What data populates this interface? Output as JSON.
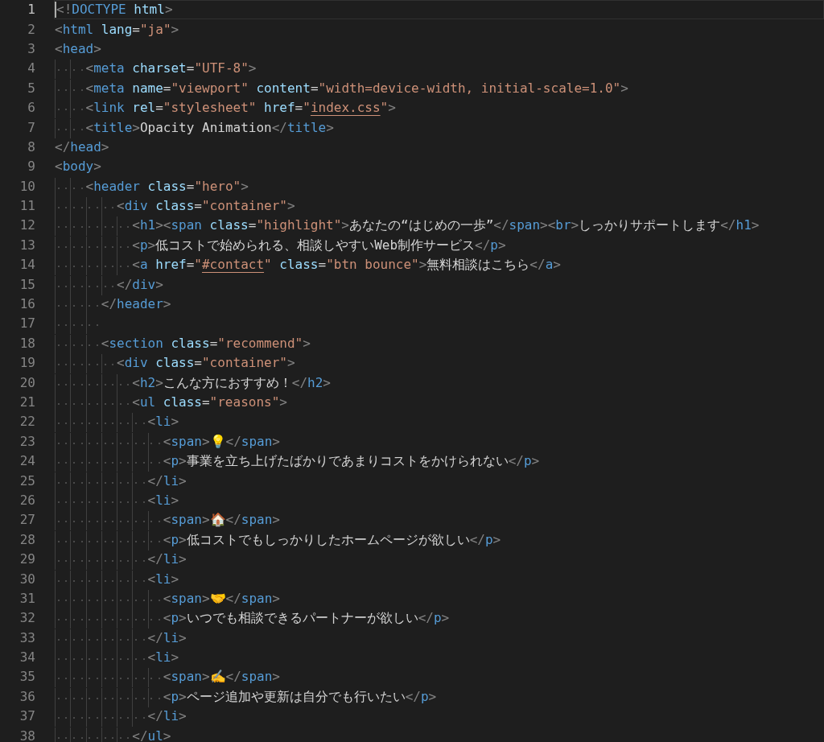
{
  "editor": {
    "lines": [
      {
        "number": "1",
        "current": true,
        "tokens": [
          {
            "kind": "punct",
            "text": "<!"
          },
          {
            "kind": "tag",
            "text": "DOCTYPE"
          },
          {
            "kind": "attr",
            "text": " html"
          },
          {
            "kind": "punct",
            "text": ">"
          }
        ]
      },
      {
        "number": "2",
        "current": false,
        "tokens": [
          {
            "kind": "punct",
            "text": "<"
          },
          {
            "kind": "tag",
            "text": "html"
          },
          {
            "kind": "attr",
            "text": " lang"
          },
          {
            "kind": "text",
            "text": "="
          },
          {
            "kind": "string",
            "text": "\"ja\""
          },
          {
            "kind": "punct",
            "text": ">"
          }
        ]
      },
      {
        "number": "3",
        "current": false,
        "tokens": [
          {
            "kind": "punct",
            "text": "<"
          },
          {
            "kind": "tag",
            "text": "head"
          },
          {
            "kind": "punct",
            "text": ">"
          }
        ]
      },
      {
        "number": "4",
        "current": false,
        "tokens": [
          {
            "kind": "punct",
            "text": "    <"
          },
          {
            "kind": "tag",
            "text": "meta"
          },
          {
            "kind": "attr",
            "text": " charset"
          },
          {
            "kind": "text",
            "text": "="
          },
          {
            "kind": "string",
            "text": "\"UTF-8\""
          },
          {
            "kind": "punct",
            "text": ">"
          }
        ]
      },
      {
        "number": "5",
        "current": false,
        "tokens": [
          {
            "kind": "punct",
            "text": "    <"
          },
          {
            "kind": "tag",
            "text": "meta"
          },
          {
            "kind": "attr",
            "text": " name"
          },
          {
            "kind": "text",
            "text": "="
          },
          {
            "kind": "string",
            "text": "\"viewport\""
          },
          {
            "kind": "attr",
            "text": " content"
          },
          {
            "kind": "text",
            "text": "="
          },
          {
            "kind": "string",
            "text": "\"width=device-width, initial-scale=1.0\""
          },
          {
            "kind": "punct",
            "text": ">"
          }
        ]
      },
      {
        "number": "6",
        "current": false,
        "tokens": [
          {
            "kind": "punct",
            "text": "    <"
          },
          {
            "kind": "tag",
            "text": "link"
          },
          {
            "kind": "attr",
            "text": " rel"
          },
          {
            "kind": "text",
            "text": "="
          },
          {
            "kind": "string",
            "text": "\"stylesheet\""
          },
          {
            "kind": "attr",
            "text": " href"
          },
          {
            "kind": "text",
            "text": "="
          },
          {
            "kind": "string",
            "text": "\""
          },
          {
            "kind": "link",
            "text": "index.css"
          },
          {
            "kind": "string",
            "text": "\""
          },
          {
            "kind": "punct",
            "text": ">"
          }
        ]
      },
      {
        "number": "7",
        "current": false,
        "tokens": [
          {
            "kind": "punct",
            "text": "    <"
          },
          {
            "kind": "tag",
            "text": "title"
          },
          {
            "kind": "punct",
            "text": ">"
          },
          {
            "kind": "text",
            "text": "Opacity Animation"
          },
          {
            "kind": "punct",
            "text": "</"
          },
          {
            "kind": "tag",
            "text": "title"
          },
          {
            "kind": "punct",
            "text": ">"
          }
        ]
      },
      {
        "number": "8",
        "current": false,
        "tokens": [
          {
            "kind": "punct",
            "text": "</"
          },
          {
            "kind": "tag",
            "text": "head"
          },
          {
            "kind": "punct",
            "text": ">"
          }
        ]
      },
      {
        "number": "9",
        "current": false,
        "tokens": [
          {
            "kind": "punct",
            "text": "<"
          },
          {
            "kind": "tag",
            "text": "body"
          },
          {
            "kind": "punct",
            "text": ">"
          }
        ]
      },
      {
        "number": "10",
        "current": false,
        "tokens": [
          {
            "kind": "punct",
            "text": "    <"
          },
          {
            "kind": "tag",
            "text": "header"
          },
          {
            "kind": "attr",
            "text": " class"
          },
          {
            "kind": "text",
            "text": "="
          },
          {
            "kind": "string",
            "text": "\"hero\""
          },
          {
            "kind": "punct",
            "text": ">"
          }
        ]
      },
      {
        "number": "11",
        "current": false,
        "tokens": [
          {
            "kind": "punct",
            "text": "        <"
          },
          {
            "kind": "tag",
            "text": "div"
          },
          {
            "kind": "attr",
            "text": " class"
          },
          {
            "kind": "text",
            "text": "="
          },
          {
            "kind": "string",
            "text": "\"container\""
          },
          {
            "kind": "punct",
            "text": ">"
          }
        ]
      },
      {
        "number": "12",
        "current": false,
        "tokens": [
          {
            "kind": "punct",
            "text": "          <"
          },
          {
            "kind": "tag",
            "text": "h1"
          },
          {
            "kind": "punct",
            "text": "><"
          },
          {
            "kind": "tag",
            "text": "span"
          },
          {
            "kind": "attr",
            "text": " class"
          },
          {
            "kind": "text",
            "text": "="
          },
          {
            "kind": "string",
            "text": "\"highlight\""
          },
          {
            "kind": "punct",
            "text": ">"
          },
          {
            "kind": "text",
            "text": "あなたの“はじめの一歩”"
          },
          {
            "kind": "punct",
            "text": "</"
          },
          {
            "kind": "tag",
            "text": "span"
          },
          {
            "kind": "punct",
            "text": "><"
          },
          {
            "kind": "tag",
            "text": "br"
          },
          {
            "kind": "punct",
            "text": ">"
          },
          {
            "kind": "text",
            "text": "しっかりサポートします"
          },
          {
            "kind": "punct",
            "text": "</"
          },
          {
            "kind": "tag",
            "text": "h1"
          },
          {
            "kind": "punct",
            "text": ">"
          }
        ]
      },
      {
        "number": "13",
        "current": false,
        "tokens": [
          {
            "kind": "punct",
            "text": "          <"
          },
          {
            "kind": "tag",
            "text": "p"
          },
          {
            "kind": "punct",
            "text": ">"
          },
          {
            "kind": "text",
            "text": "低コストで始められる、相談しやすいWeb制作サービス"
          },
          {
            "kind": "punct",
            "text": "</"
          },
          {
            "kind": "tag",
            "text": "p"
          },
          {
            "kind": "punct",
            "text": ">"
          }
        ]
      },
      {
        "number": "14",
        "current": false,
        "tokens": [
          {
            "kind": "punct",
            "text": "          <"
          },
          {
            "kind": "tag",
            "text": "a"
          },
          {
            "kind": "attr",
            "text": " href"
          },
          {
            "kind": "text",
            "text": "="
          },
          {
            "kind": "string",
            "text": "\""
          },
          {
            "kind": "link",
            "text": "#contact"
          },
          {
            "kind": "string",
            "text": "\""
          },
          {
            "kind": "attr",
            "text": " class"
          },
          {
            "kind": "text",
            "text": "="
          },
          {
            "kind": "string",
            "text": "\"btn bounce\""
          },
          {
            "kind": "punct",
            "text": ">"
          },
          {
            "kind": "text",
            "text": "無料相談はこちら"
          },
          {
            "kind": "punct",
            "text": "</"
          },
          {
            "kind": "tag",
            "text": "a"
          },
          {
            "kind": "punct",
            "text": ">"
          }
        ]
      },
      {
        "number": "15",
        "current": false,
        "tokens": [
          {
            "kind": "punct",
            "text": "        </"
          },
          {
            "kind": "tag",
            "text": "div"
          },
          {
            "kind": "punct",
            "text": ">"
          }
        ]
      },
      {
        "number": "16",
        "current": false,
        "tokens": [
          {
            "kind": "punct",
            "text": "      </"
          },
          {
            "kind": "tag",
            "text": "header"
          },
          {
            "kind": "punct",
            "text": ">"
          }
        ]
      },
      {
        "number": "17",
        "current": false
      },
      {
        "number": "18",
        "current": false,
        "tokens": [
          {
            "kind": "punct",
            "text": "      <"
          },
          {
            "kind": "tag",
            "text": "section"
          },
          {
            "kind": "attr",
            "text": " class"
          },
          {
            "kind": "text",
            "text": "="
          },
          {
            "kind": "string",
            "text": "\"recommend\""
          },
          {
            "kind": "punct",
            "text": ">"
          }
        ]
      },
      {
        "number": "19",
        "current": false,
        "tokens": [
          {
            "kind": "punct",
            "text": "        <"
          },
          {
            "kind": "tag",
            "text": "div"
          },
          {
            "kind": "attr",
            "text": " class"
          },
          {
            "kind": "text",
            "text": "="
          },
          {
            "kind": "string",
            "text": "\"container\""
          },
          {
            "kind": "punct",
            "text": ">"
          }
        ]
      },
      {
        "number": "20",
        "current": false,
        "tokens": [
          {
            "kind": "punct",
            "text": "          <"
          },
          {
            "kind": "tag",
            "text": "h2"
          },
          {
            "kind": "punct",
            "text": ">"
          },
          {
            "kind": "text",
            "text": "こんな方におすすめ！"
          },
          {
            "kind": "punct",
            "text": "</"
          },
          {
            "kind": "tag",
            "text": "h2"
          },
          {
            "kind": "punct",
            "text": ">"
          }
        ]
      },
      {
        "number": "21",
        "current": false,
        "tokens": [
          {
            "kind": "punct",
            "text": "          <"
          },
          {
            "kind": "tag",
            "text": "ul"
          },
          {
            "kind": "attr",
            "text": " class"
          },
          {
            "kind": "text",
            "text": "="
          },
          {
            "kind": "string",
            "text": "\"reasons\""
          },
          {
            "kind": "punct",
            "text": ">"
          }
        ]
      },
      {
        "number": "22",
        "current": false,
        "tokens": [
          {
            "kind": "punct",
            "text": "            <"
          },
          {
            "kind": "tag",
            "text": "li"
          },
          {
            "kind": "punct",
            "text": ">"
          }
        ]
      },
      {
        "number": "23",
        "current": false,
        "tokens": [
          {
            "kind": "punct",
            "text": "              <"
          },
          {
            "kind": "tag",
            "text": "span"
          },
          {
            "kind": "punct",
            "text": ">"
          },
          {
            "kind": "text",
            "text": "💡"
          },
          {
            "kind": "punct",
            "text": "</"
          },
          {
            "kind": "tag",
            "text": "span"
          },
          {
            "kind": "punct",
            "text": ">"
          }
        ]
      },
      {
        "number": "24",
        "current": false,
        "tokens": [
          {
            "kind": "punct",
            "text": "              <"
          },
          {
            "kind": "tag",
            "text": "p"
          },
          {
            "kind": "punct",
            "text": ">"
          },
          {
            "kind": "text",
            "text": "事業を立ち上げたばかりであまりコストをかけられない"
          },
          {
            "kind": "punct",
            "text": "</"
          },
          {
            "kind": "tag",
            "text": "p"
          },
          {
            "kind": "punct",
            "text": ">"
          }
        ]
      },
      {
        "number": "25",
        "current": false,
        "tokens": [
          {
            "kind": "punct",
            "text": "            </"
          },
          {
            "kind": "tag",
            "text": "li"
          },
          {
            "kind": "punct",
            "text": ">"
          }
        ]
      },
      {
        "number": "26",
        "current": false,
        "tokens": [
          {
            "kind": "punct",
            "text": "            <"
          },
          {
            "kind": "tag",
            "text": "li"
          },
          {
            "kind": "punct",
            "text": ">"
          }
        ]
      },
      {
        "number": "27",
        "current": false,
        "tokens": [
          {
            "kind": "punct",
            "text": "              <"
          },
          {
            "kind": "tag",
            "text": "span"
          },
          {
            "kind": "punct",
            "text": ">"
          },
          {
            "kind": "text",
            "text": "🏠"
          },
          {
            "kind": "punct",
            "text": "</"
          },
          {
            "kind": "tag",
            "text": "span"
          },
          {
            "kind": "punct",
            "text": ">"
          }
        ]
      },
      {
        "number": "28",
        "current": false,
        "tokens": [
          {
            "kind": "punct",
            "text": "              <"
          },
          {
            "kind": "tag",
            "text": "p"
          },
          {
            "kind": "punct",
            "text": ">"
          },
          {
            "kind": "text",
            "text": "低コストでもしっかりしたホームページが欲しい"
          },
          {
            "kind": "punct",
            "text": "</"
          },
          {
            "kind": "tag",
            "text": "p"
          },
          {
            "kind": "punct",
            "text": ">"
          }
        ]
      },
      {
        "number": "29",
        "current": false,
        "tokens": [
          {
            "kind": "punct",
            "text": "            </"
          },
          {
            "kind": "tag",
            "text": "li"
          },
          {
            "kind": "punct",
            "text": ">"
          }
        ]
      },
      {
        "number": "30",
        "current": false,
        "tokens": [
          {
            "kind": "punct",
            "text": "            <"
          },
          {
            "kind": "tag",
            "text": "li"
          },
          {
            "kind": "punct",
            "text": ">"
          }
        ]
      },
      {
        "number": "31",
        "current": false,
        "tokens": [
          {
            "kind": "punct",
            "text": "              <"
          },
          {
            "kind": "tag",
            "text": "span"
          },
          {
            "kind": "punct",
            "text": ">"
          },
          {
            "kind": "text",
            "text": "🤝"
          },
          {
            "kind": "punct",
            "text": "</"
          },
          {
            "kind": "tag",
            "text": "span"
          },
          {
            "kind": "punct",
            "text": ">"
          }
        ]
      },
      {
        "number": "32",
        "current": false,
        "tokens": [
          {
            "kind": "punct",
            "text": "              <"
          },
          {
            "kind": "tag",
            "text": "p"
          },
          {
            "kind": "punct",
            "text": ">"
          },
          {
            "kind": "text",
            "text": "いつでも相談できるパートナーが欲しい"
          },
          {
            "kind": "punct",
            "text": "</"
          },
          {
            "kind": "tag",
            "text": "p"
          },
          {
            "kind": "punct",
            "text": ">"
          }
        ]
      },
      {
        "number": "33",
        "current": false,
        "tokens": [
          {
            "kind": "punct",
            "text": "            </"
          },
          {
            "kind": "tag",
            "text": "li"
          },
          {
            "kind": "punct",
            "text": ">"
          }
        ]
      },
      {
        "number": "34",
        "current": false,
        "tokens": [
          {
            "kind": "punct",
            "text": "            <"
          },
          {
            "kind": "tag",
            "text": "li"
          },
          {
            "kind": "punct",
            "text": ">"
          }
        ]
      },
      {
        "number": "35",
        "current": false,
        "tokens": [
          {
            "kind": "punct",
            "text": "              <"
          },
          {
            "kind": "tag",
            "text": "span"
          },
          {
            "kind": "punct",
            "text": ">"
          },
          {
            "kind": "text",
            "text": "✍️"
          },
          {
            "kind": "punct",
            "text": "</"
          },
          {
            "kind": "tag",
            "text": "span"
          },
          {
            "kind": "punct",
            "text": ">"
          }
        ]
      },
      {
        "number": "36",
        "current": false,
        "tokens": [
          {
            "kind": "punct",
            "text": "              <"
          },
          {
            "kind": "tag",
            "text": "p"
          },
          {
            "kind": "punct",
            "text": ">"
          },
          {
            "kind": "text",
            "text": "ページ追加や更新は自分でも行いたい"
          },
          {
            "kind": "punct",
            "text": "</"
          },
          {
            "kind": "tag",
            "text": "p"
          },
          {
            "kind": "punct",
            "text": ">"
          }
        ]
      },
      {
        "number": "37",
        "current": false,
        "tokens": [
          {
            "kind": "punct",
            "text": "            </"
          },
          {
            "kind": "tag",
            "text": "li"
          },
          {
            "kind": "punct",
            "text": ">"
          }
        ]
      },
      {
        "number": "38",
        "current": false,
        "tokens": [
          {
            "kind": "punct",
            "text": "          </"
          },
          {
            "kind": "tag",
            "text": "ul"
          },
          {
            "kind": "punct",
            "text": ">"
          }
        ]
      }
    ]
  }
}
